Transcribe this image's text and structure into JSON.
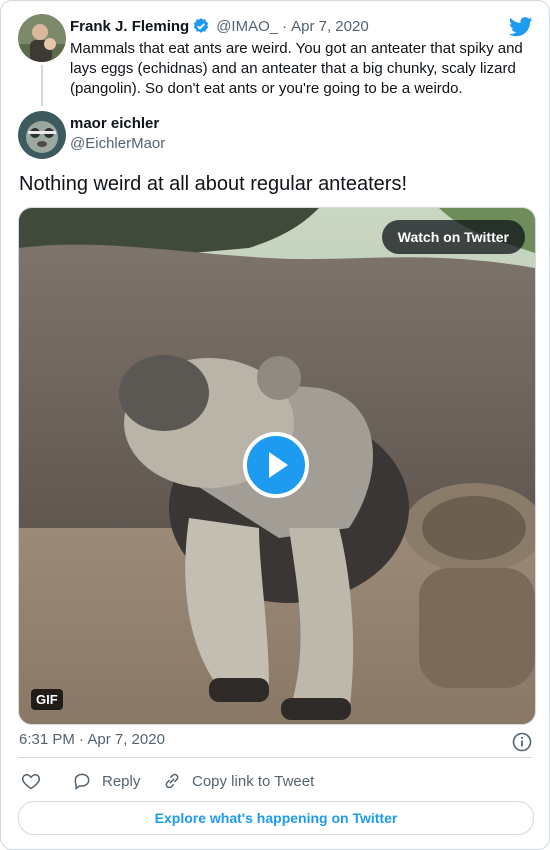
{
  "original_tweet": {
    "author_name": "Frank J. Fleming",
    "handle": "@IMAO_",
    "separator": "·",
    "date": "Apr 7, 2020",
    "text": "Mammals that eat ants are weird. You got an anteater that spiky and lays eggs (echidnas) and an anteater that a big chunky, scaly lizard (pangolin). So don't eat ants or you're going to be a weirdo.",
    "verified": true
  },
  "reply_tweet": {
    "author_name": "maor eichler",
    "handle": "@EichlerMaor",
    "text": "Nothing weird at all about regular anteaters!"
  },
  "media": {
    "watch_label": "Watch on Twitter",
    "badge": "GIF"
  },
  "footer": {
    "timestamp": "6:31 PM · Apr 7, 2020",
    "reply_label": "Reply",
    "copy_label": "Copy link to Tweet",
    "explore_label": "Explore what's happening on Twitter"
  },
  "colors": {
    "accent": "#1d9bf0",
    "muted": "#536471",
    "border": "#cfd9de"
  },
  "icons": [
    "twitter-bird-icon",
    "verified-badge-icon",
    "play-icon",
    "info-icon",
    "heart-icon",
    "reply-icon",
    "link-icon"
  ]
}
